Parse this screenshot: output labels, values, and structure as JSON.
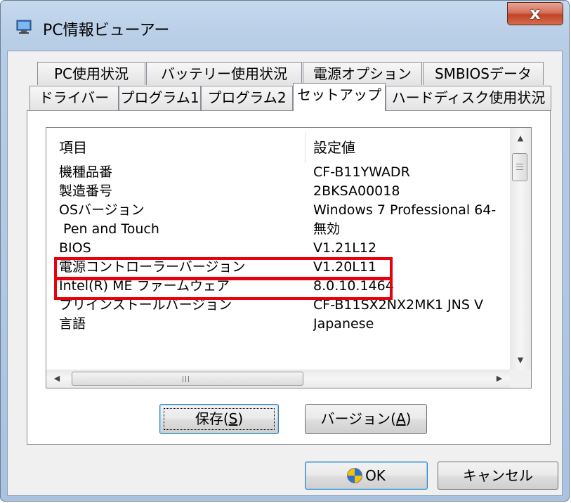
{
  "window": {
    "title": "PC情報ビューアー",
    "close_glyph": "x"
  },
  "tabs": {
    "row_back": [
      "PC使用状況",
      "バッテリー使用状況",
      "電源オプション",
      "SMBIOSデータ"
    ],
    "row_front": [
      "ドライバー",
      "プログラム1",
      "プログラム2",
      "セットアップ",
      "ハードディスク使用状況"
    ],
    "active": "セットアップ"
  },
  "list": {
    "columns": [
      "項目",
      "設定値"
    ],
    "rows": [
      {
        "item": "機種品番",
        "value": "CF-B11YWADR"
      },
      {
        "item": "製造番号",
        "value": "2BKSA00018"
      },
      {
        "item": "OSバージョン",
        "value": "Windows 7 Professional 64-"
      },
      {
        "item": " Pen and Touch",
        "value": "無効"
      },
      {
        "item": "BIOS",
        "value": "V1.21L12"
      },
      {
        "item": "電源コントローラーバージョン",
        "value": "V1.20L11"
      },
      {
        "item": "Intel(R) ME ファームウェア",
        "value": "8.0.10.1464"
      },
      {
        "item": "プリインストールバージョン",
        "value": "CF-B11SX2NX2MK1 JNS V"
      },
      {
        "item": "言語",
        "value": "Japanese"
      }
    ],
    "highlighted_rows": [
      "BIOS",
      "電源コントローラーバージョン"
    ]
  },
  "buttons": {
    "save_text": "保存(",
    "save_key": "S",
    "save_end": ")",
    "version_text": "バージョン(",
    "version_key": "A",
    "version_end": ")",
    "ok": "OK",
    "cancel": "キャンセル"
  },
  "icons": {
    "app": "monitor-icon",
    "ok": "uac-shield-icon"
  },
  "colors": {
    "highlight": "#e8000b",
    "title_bar": "#b7cde6",
    "close_button": "#c2432a"
  }
}
